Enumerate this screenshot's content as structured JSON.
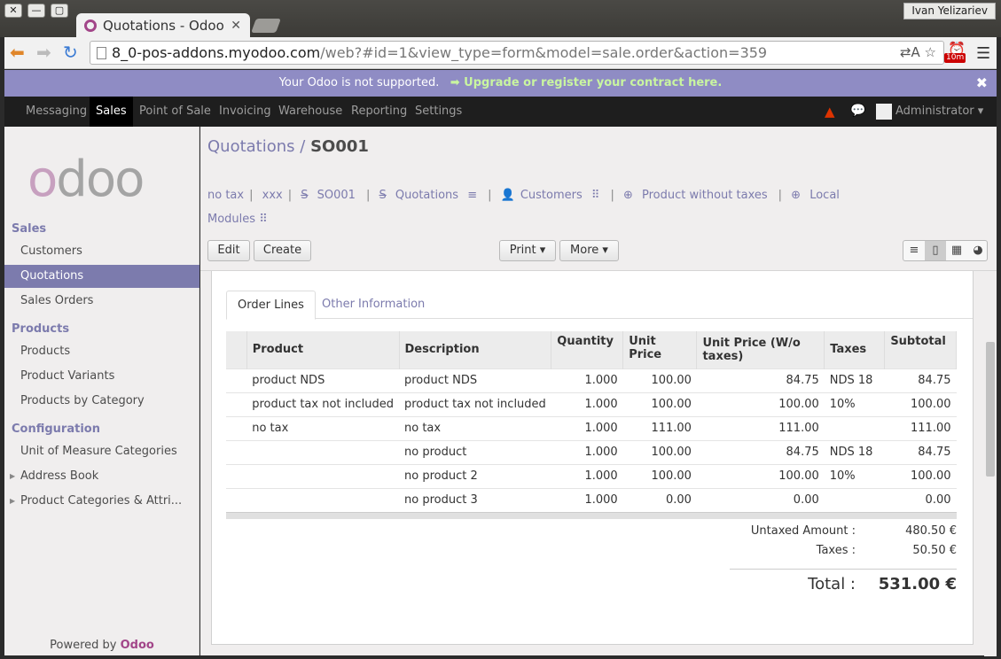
{
  "window": {
    "tab_title": "Quotations - Odoo",
    "user": "Ivan Yelizariev",
    "btn_close": "✕",
    "btn_min": "—",
    "btn_max": "▢"
  },
  "browser": {
    "url_host": "8_0-pos-addons.myodoo.com",
    "url_path": "/web?#id=1&view_type=form&model=sale.order&action=359",
    "ext_badge": "10m"
  },
  "announce": {
    "text": "Your Odoo is not supported.",
    "link": "➡ Upgrade or register your contract here."
  },
  "topmenu": {
    "items": [
      "Messaging",
      "Sales",
      "Point of Sale",
      "Invoicing",
      "Warehouse",
      "Reporting",
      "Settings"
    ],
    "user": "Administrator"
  },
  "sidebar": {
    "brand": "odoo",
    "sections": [
      {
        "title": "Sales",
        "items": [
          "Customers",
          "Quotations",
          "Sales Orders"
        ]
      },
      {
        "title": "Products",
        "items": [
          "Products",
          "Product Variants",
          "Products by Category"
        ]
      },
      {
        "title": "Configuration",
        "items": [
          "Unit of Measure Categories",
          "Address Book",
          "Product Categories & Attri..."
        ]
      }
    ],
    "powered_prefix": "Powered by",
    "powered_brand": "Odoo"
  },
  "breadcrumb": {
    "parent": "Quotations",
    "sep": " / ",
    "current": "SO001"
  },
  "filters": [
    "no tax",
    "xxx",
    "SO001",
    "Quotations",
    "Customers",
    "Product without taxes",
    "Local"
  ],
  "modules_label": "Modules",
  "buttons": {
    "edit": "Edit",
    "create": "Create",
    "print": "Print ▾",
    "more": "More ▾"
  },
  "tabs": [
    "Order Lines",
    "Other Information"
  ],
  "table": {
    "headers": [
      "Product",
      "Description",
      "Quantity",
      "Unit Price",
      "Unit Price (W/o taxes)",
      "Taxes",
      "Subtotal"
    ],
    "rows": [
      [
        "product NDS",
        "product NDS",
        "1.000",
        "100.00",
        "84.75",
        "NDS 18",
        "84.75"
      ],
      [
        "product tax not included",
        "product tax not included",
        "1.000",
        "100.00",
        "100.00",
        "10%",
        "100.00"
      ],
      [
        "no tax",
        "no tax",
        "1.000",
        "111.00",
        "111.00",
        "",
        "111.00"
      ],
      [
        "",
        "no product",
        "1.000",
        "100.00",
        "84.75",
        "NDS 18",
        "84.75"
      ],
      [
        "",
        "no product 2",
        "1.000",
        "100.00",
        "100.00",
        "10%",
        "100.00"
      ],
      [
        "",
        "no product 3",
        "1.000",
        "0.00",
        "0.00",
        "",
        "0.00"
      ]
    ]
  },
  "totals": {
    "untaxed_label": "Untaxed Amount :",
    "untaxed": "480.50 €",
    "taxes_label": "Taxes :",
    "taxes": "50.50 €",
    "total_label": "Total :",
    "total": "531.00 €"
  },
  "colors": {
    "accent": "#7c7bad",
    "brand_pink": "#a24689",
    "announce": "#8f8cc4"
  }
}
